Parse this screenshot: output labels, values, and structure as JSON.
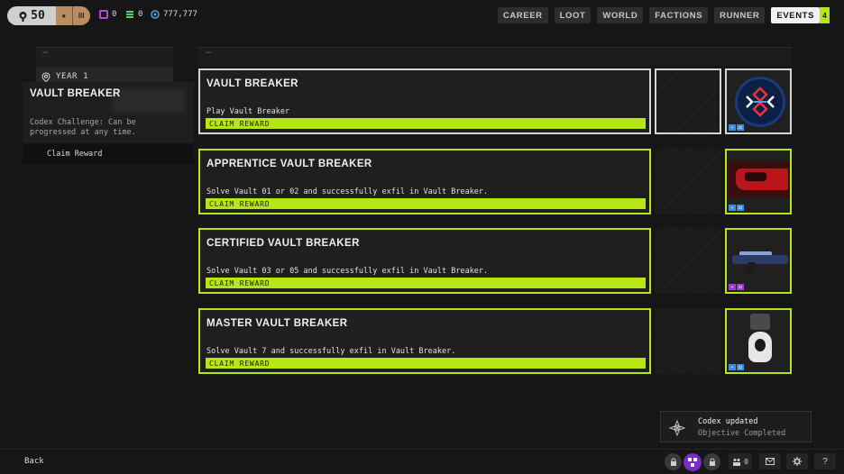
{
  "topbar": {
    "rank_value": "50",
    "rank_tier": "III",
    "currencies": [
      {
        "value": "0",
        "color": "#b34bd6",
        "icon": "box-icon"
      },
      {
        "value": "0",
        "color": "#59d16a",
        "icon": "stack-icon"
      },
      {
        "value": "777,777",
        "color": "#4aa3e6",
        "icon": "coin-icon"
      }
    ],
    "nav": [
      "CAREER",
      "LOOT",
      "WORLD",
      "FACTIONS",
      "RUNNER",
      "EVENTS"
    ],
    "active_nav": "EVENTS",
    "events_badge": "4"
  },
  "sidebar": {
    "year_label": "YEAR 1",
    "card_title": "VAULT BREAKER",
    "card_desc": "Codex Challenge: Can be progressed at any time.",
    "claim_label": "Claim Reward"
  },
  "challenges": [
    {
      "name": "VAULT BREAKER",
      "objective": "Play Vault Breaker",
      "claim": "CLAIM REWARD",
      "reward": "emblem"
    },
    {
      "name": "APPRENTICE VAULT BREAKER",
      "objective": "Solve Vault 01 or 02 and successfully exfil in Vault Breaker.",
      "claim": "CLAIM REWARD",
      "reward": "vehicle"
    },
    {
      "name": "CERTIFIED VAULT BREAKER",
      "objective": "Solve Vault 03 or 05 and successfully exfil in Vault Breaker.",
      "claim": "CLAIM REWARD",
      "reward": "weapon"
    },
    {
      "name": "MASTER VAULT BREAKER",
      "objective": "Solve Vault 7 and successfully exfil in Vault Breaker.",
      "claim": "CLAIM REWARD",
      "reward": "figure"
    }
  ],
  "toast": {
    "title": "Codex updated",
    "subtitle": "Objective Completed"
  },
  "bottombar": {
    "back_label": "Back",
    "party_count": "0"
  },
  "colors": {
    "accent": "#b6e615",
    "panel": "#1f1f1f",
    "background": "#161616"
  }
}
